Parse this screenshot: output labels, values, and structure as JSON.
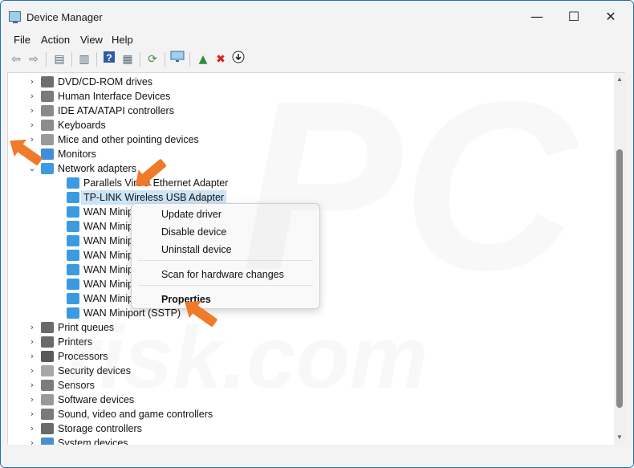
{
  "window": {
    "title": "Device Manager"
  },
  "title_buttons": {
    "minimize": "—",
    "maximize": "☐",
    "close": "✕"
  },
  "menu": [
    "File",
    "Action",
    "View",
    "Help"
  ],
  "toolbar": {
    "icons": [
      "back-arrow-icon",
      "forward-arrow-icon",
      "show-hide-console-tree-icon",
      "properties-sheet-icon",
      "help-icon",
      "view-action-pane-icon",
      "update-driver-icon",
      "monitor-icon",
      "enable-device-icon",
      "uninstall-device-icon",
      "download-icon"
    ]
  },
  "tree": {
    "rows": [
      {
        "label": "DVD/CD-ROM drives",
        "level": 0,
        "expander": "›",
        "icon": "dvd-drive-icon",
        "color": "#6d6d6d"
      },
      {
        "label": "Human Interface Devices",
        "level": 0,
        "expander": "›",
        "icon": "hid-icon",
        "color": "#7a7a7a"
      },
      {
        "label": "IDE ATA/ATAPI controllers",
        "level": 0,
        "expander": "›",
        "icon": "ide-controller-icon",
        "color": "#8a8a8a"
      },
      {
        "label": "Keyboards",
        "level": 0,
        "expander": "›",
        "icon": "keyboard-icon",
        "color": "#8c8c8c"
      },
      {
        "label": "Mice and other pointing devices",
        "level": 0,
        "expander": "›",
        "icon": "mouse-icon",
        "color": "#9a9a9a"
      },
      {
        "label": "Monitors",
        "level": 0,
        "expander": "›",
        "icon": "monitor-icon",
        "color": "#3d8fd8"
      },
      {
        "label": "Network adapters",
        "level": 0,
        "expander": "⌄",
        "icon": "network-adapter-icon",
        "color": "#3c9be0"
      },
      {
        "label": "Parallels VirtIO Ethernet Adapter",
        "level": 1,
        "expander": "",
        "icon": "network-adapter-icon",
        "color": "#3c9be0"
      },
      {
        "label": "TP-LINK Wireless USB Adapter",
        "level": 1,
        "expander": "",
        "icon": "network-adapter-icon",
        "color": "#3c9be0",
        "selected": true
      },
      {
        "label": "WAN Miniport (IKEv2)",
        "level": 1,
        "expander": "",
        "icon": "network-adapter-icon",
        "color": "#3c9be0"
      },
      {
        "label": "WAN Miniport (IP)",
        "level": 1,
        "expander": "",
        "icon": "network-adapter-icon",
        "color": "#3c9be0"
      },
      {
        "label": "WAN Miniport (IPv6)",
        "level": 1,
        "expander": "",
        "icon": "network-adapter-icon",
        "color": "#3c9be0"
      },
      {
        "label": "WAN Miniport (L2TP)",
        "level": 1,
        "expander": "",
        "icon": "network-adapter-icon",
        "color": "#3c9be0"
      },
      {
        "label": "WAN Miniport (Network Monitor)",
        "level": 1,
        "expander": "",
        "icon": "network-adapter-icon",
        "color": "#3c9be0"
      },
      {
        "label": "WAN Miniport (PPPOE)",
        "level": 1,
        "expander": "",
        "icon": "network-adapter-icon",
        "color": "#3c9be0"
      },
      {
        "label": "WAN Miniport (PPTP)",
        "level": 1,
        "expander": "",
        "icon": "network-adapter-icon",
        "color": "#3c9be0"
      },
      {
        "label": "WAN Miniport (SSTP)",
        "level": 1,
        "expander": "",
        "icon": "network-adapter-icon",
        "color": "#3c9be0"
      },
      {
        "label": "Print queues",
        "level": 0,
        "expander": "›",
        "icon": "printer-icon",
        "color": "#6a6a6a"
      },
      {
        "label": "Printers",
        "level": 0,
        "expander": "›",
        "icon": "printer-icon",
        "color": "#6a6a6a"
      },
      {
        "label": "Processors",
        "level": 0,
        "expander": "›",
        "icon": "processor-icon",
        "color": "#5a5a5a"
      },
      {
        "label": "Security devices",
        "level": 0,
        "expander": "›",
        "icon": "security-device-icon",
        "color": "#a8a8a8"
      },
      {
        "label": "Sensors",
        "level": 0,
        "expander": "›",
        "icon": "sensor-icon",
        "color": "#7c7c7c"
      },
      {
        "label": "Software devices",
        "level": 0,
        "expander": "›",
        "icon": "software-device-icon",
        "color": "#9a9a9a"
      },
      {
        "label": "Sound, video and game controllers",
        "level": 0,
        "expander": "›",
        "icon": "sound-icon",
        "color": "#7a7a7a"
      },
      {
        "label": "Storage controllers",
        "level": 0,
        "expander": "›",
        "icon": "storage-controller-icon",
        "color": "#6a6a6a"
      },
      {
        "label": "System devices",
        "level": 0,
        "expander": "›",
        "icon": "system-device-icon",
        "color": "#4a8fd0"
      }
    ]
  },
  "context_menu": {
    "items": [
      {
        "label": "Update driver",
        "bold": false
      },
      {
        "label": "Disable device",
        "bold": false
      },
      {
        "label": "Uninstall device",
        "bold": false
      },
      {
        "label": "Scan for hardware changes",
        "bold": false
      },
      {
        "label": "Properties",
        "bold": true
      }
    ]
  },
  "watermark": {
    "line1": "PC",
    "line2": "risk.com"
  },
  "accent_color": "#ef7a2a"
}
